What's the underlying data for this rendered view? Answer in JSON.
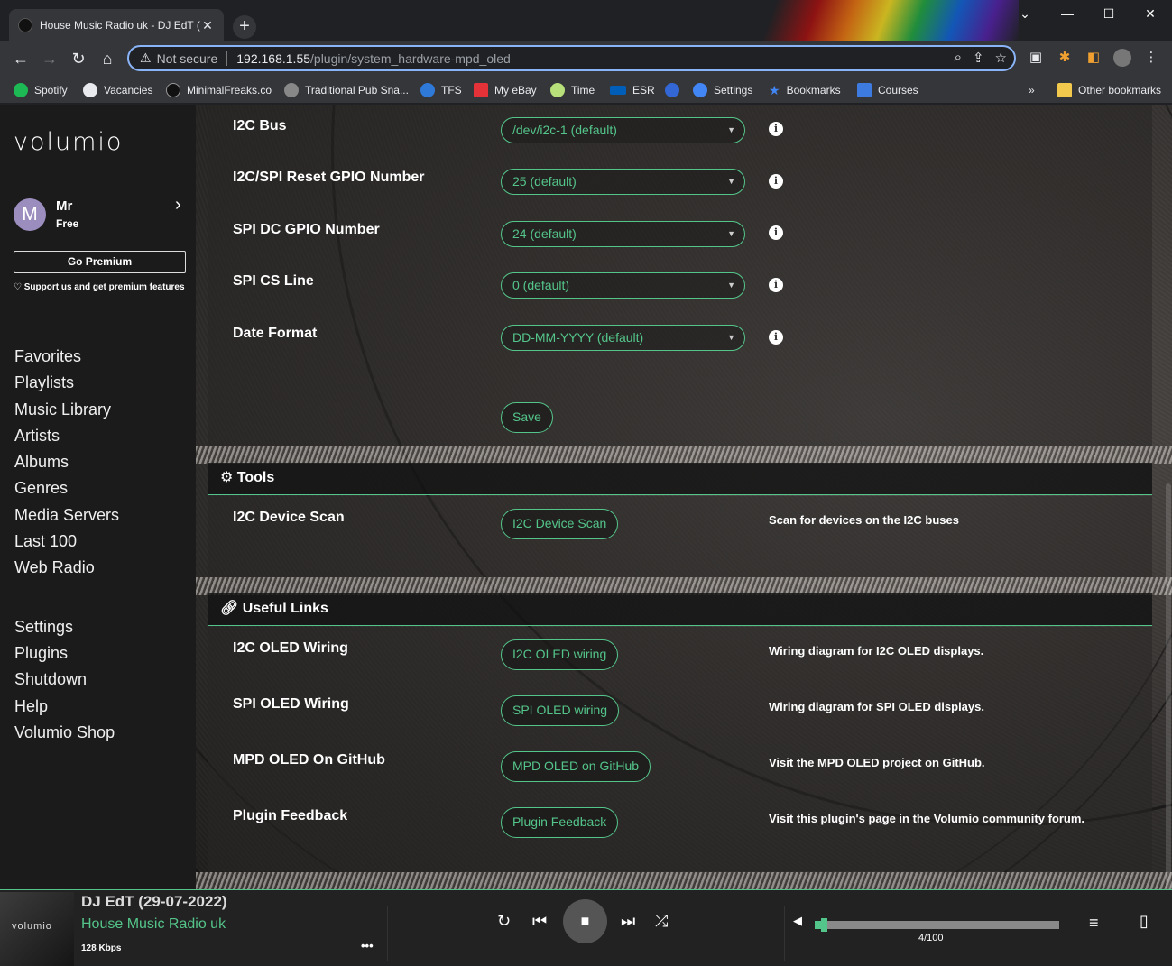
{
  "browser": {
    "tab_title": "House Music Radio uk - DJ EdT (",
    "new_tab": "+",
    "not_secure": "Not secure",
    "url_host": "192.168.1.55",
    "url_path": "/plugin/system_hardware-mpd_oled",
    "bookmarks": [
      {
        "label": "Spotify",
        "color": "#1db954"
      },
      {
        "label": "Vacancies",
        "color": "#e8eaed"
      },
      {
        "label": "MinimalFreaks.co",
        "color": "#222222"
      },
      {
        "label": "Traditional Pub Sna...",
        "color": "#888888"
      },
      {
        "label": "TFS",
        "color": "#2f7ad9"
      },
      {
        "label": "My eBay",
        "color": "#e53238"
      },
      {
        "label": "Time",
        "color": "#b8e07a"
      },
      {
        "label": "ESR",
        "color": "#005eb8"
      },
      {
        "label": "",
        "color": "#3367d6"
      },
      {
        "label": "Settings",
        "color": "#4285f4"
      },
      {
        "label": "Bookmarks",
        "color": "#4285f4"
      },
      {
        "label": "Courses",
        "color": "#3d7be0"
      }
    ],
    "more_bookmarks": "»",
    "other_bookmarks": "Other bookmarks"
  },
  "sidebar": {
    "logo": "volumio",
    "user_initial": "M",
    "user_name": "Mr",
    "user_plan": "Free",
    "go_premium": "Go Premium",
    "support_text": "Support us and get premium features",
    "nav_primary": [
      "Favorites",
      "Playlists",
      "Music Library",
      "Artists",
      "Albums",
      "Genres",
      "Media Servers",
      "Last 100",
      "Web Radio"
    ],
    "nav_secondary": [
      "Settings",
      "Plugins",
      "Shutdown",
      "Help",
      "Volumio Shop"
    ]
  },
  "settings_rows": [
    {
      "label": "I2C Bus",
      "value": "/dev/i2c-1 (default)"
    },
    {
      "label": "I2C/SPI Reset GPIO Number",
      "value": "25 (default)"
    },
    {
      "label": "SPI DC GPIO Number",
      "value": "24 (default)"
    },
    {
      "label": "SPI CS Line",
      "value": "0 (default)"
    },
    {
      "label": "Date Format",
      "value": "DD-MM-YYYY (default)"
    }
  ],
  "save_label": "Save",
  "tools": {
    "title": "Tools",
    "rows": [
      {
        "label": "I2C Device Scan",
        "button": "I2C Device Scan",
        "desc": "Scan for devices on the I2C buses"
      }
    ]
  },
  "links": {
    "title": "Useful Links",
    "rows": [
      {
        "label": "I2C OLED Wiring",
        "button": "I2C OLED wiring",
        "desc": "Wiring diagram for I2C OLED displays."
      },
      {
        "label": "SPI OLED Wiring",
        "button": "SPI OLED wiring",
        "desc": "Wiring diagram for SPI OLED displays."
      },
      {
        "label": "MPD OLED On GitHub",
        "button": "MPD OLED on GitHub",
        "desc": "Visit the MPD OLED project on GitHub."
      },
      {
        "label": "Plugin Feedback",
        "button": "Plugin Feedback",
        "desc": "Visit this plugin's page in the Volumio community forum."
      }
    ]
  },
  "player": {
    "art_text": "volumio",
    "title": "DJ EdT (29-07-2022)",
    "artist": "House Music Radio uk",
    "bitrate": "128 Kbps",
    "more": "•••",
    "volume_label": "4/100",
    "volume_fraction": 0.04,
    "accent": "#54c58a"
  }
}
